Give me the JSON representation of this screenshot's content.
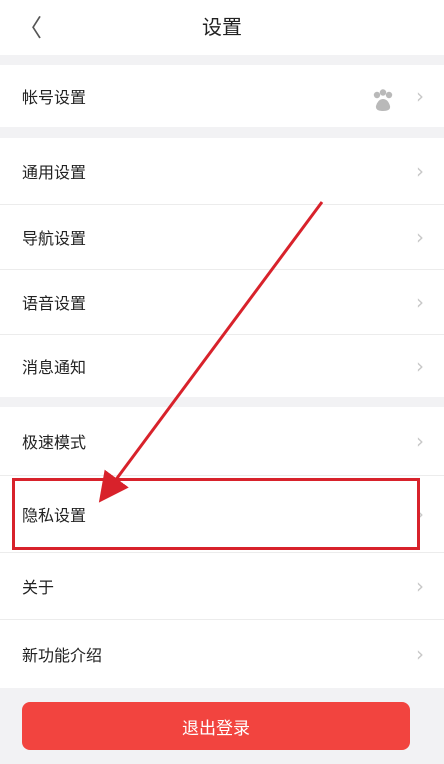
{
  "header": {
    "title": "设置",
    "back_glyph": "〈"
  },
  "items": [
    {
      "label": "帐号设置"
    },
    {
      "label": "通用设置"
    },
    {
      "label": "导航设置"
    },
    {
      "label": "语音设置"
    },
    {
      "label": "消息通知"
    },
    {
      "label": "极速模式"
    },
    {
      "label": "隐私设置"
    },
    {
      "label": "关于"
    },
    {
      "label": "新功能介绍"
    }
  ],
  "chevron": "›",
  "logout": {
    "label": "退出登录"
  },
  "colors": {
    "accent": "#f2443f",
    "highlight": "#d8222b",
    "background": "#f2f2f4"
  },
  "icons": {
    "account_badge": "baidu-paw-icon"
  }
}
